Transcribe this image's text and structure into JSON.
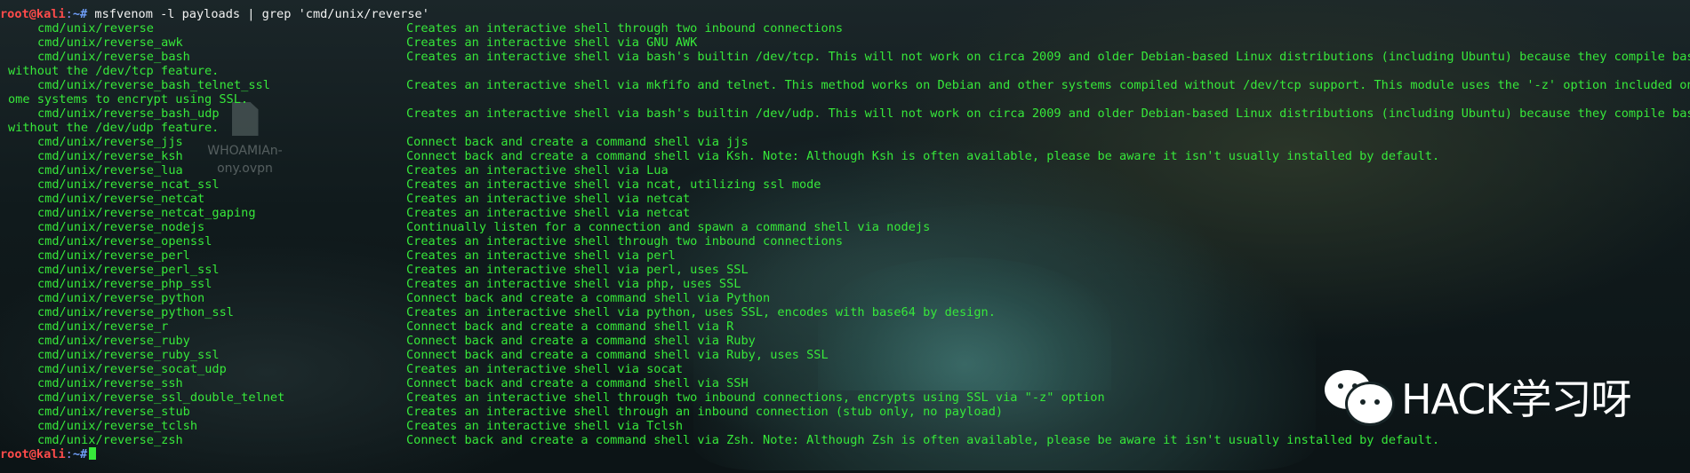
{
  "terminal": {
    "prompt": {
      "user_host": "root@kali",
      "separator": ":",
      "path": "~#"
    },
    "command": " msfvenom -l payloads | grep 'cmd/unix/reverse'",
    "payloads": [
      {
        "name": "cmd/unix/reverse",
        "desc": "Creates an interactive shell through two inbound connections"
      },
      {
        "name": "cmd/unix/reverse_awk",
        "desc": "Creates an interactive shell via GNU AWK"
      },
      {
        "name": "cmd/unix/reverse_bash",
        "desc": "Creates an interactive shell via bash's builtin /dev/tcp. This will not work on circa 2009 and older Debian-based Linux distributions (including Ubuntu) because they compile bash",
        "wrap": "without the /dev/tcp feature."
      },
      {
        "name": "cmd/unix/reverse_bash_telnet_ssl",
        "desc": "Creates an interactive shell via mkfifo and telnet. This method works on Debian and other systems compiled without /dev/tcp support. This module uses the '-z' option included on s",
        "wrap": "ome systems to encrypt using SSL."
      },
      {
        "name": "cmd/unix/reverse_bash_udp",
        "desc": "Creates an interactive shell via bash's builtin /dev/udp. This will not work on circa 2009 and older Debian-based Linux distributions (including Ubuntu) because they compile bash",
        "wrap": "without the /dev/udp feature."
      },
      {
        "name": "cmd/unix/reverse_jjs",
        "desc": "Connect back and create a command shell via jjs"
      },
      {
        "name": "cmd/unix/reverse_ksh",
        "desc": "Connect back and create a command shell via Ksh. Note: Although Ksh is often available, please be aware it isn't usually installed by default."
      },
      {
        "name": "cmd/unix/reverse_lua",
        "desc": "Creates an interactive shell via Lua"
      },
      {
        "name": "cmd/unix/reverse_ncat_ssl",
        "desc": "Creates an interactive shell via ncat, utilizing ssl mode"
      },
      {
        "name": "cmd/unix/reverse_netcat",
        "desc": "Creates an interactive shell via netcat"
      },
      {
        "name": "cmd/unix/reverse_netcat_gaping",
        "desc": "Creates an interactive shell via netcat"
      },
      {
        "name": "cmd/unix/reverse_nodejs",
        "desc": "Continually listen for a connection and spawn a command shell via nodejs"
      },
      {
        "name": "cmd/unix/reverse_openssl",
        "desc": "Creates an interactive shell through two inbound connections"
      },
      {
        "name": "cmd/unix/reverse_perl",
        "desc": "Creates an interactive shell via perl"
      },
      {
        "name": "cmd/unix/reverse_perl_ssl",
        "desc": "Creates an interactive shell via perl, uses SSL"
      },
      {
        "name": "cmd/unix/reverse_php_ssl",
        "desc": "Creates an interactive shell via php, uses SSL"
      },
      {
        "name": "cmd/unix/reverse_python",
        "desc": "Connect back and create a command shell via Python"
      },
      {
        "name": "cmd/unix/reverse_python_ssl",
        "desc": "Creates an interactive shell via python, uses SSL, encodes with base64 by design."
      },
      {
        "name": "cmd/unix/reverse_r",
        "desc": "Connect back and create a command shell via R"
      },
      {
        "name": "cmd/unix/reverse_ruby",
        "desc": "Connect back and create a command shell via Ruby"
      },
      {
        "name": "cmd/unix/reverse_ruby_ssl",
        "desc": "Connect back and create a command shell via Ruby, uses SSL"
      },
      {
        "name": "cmd/unix/reverse_socat_udp",
        "desc": "Creates an interactive shell via socat"
      },
      {
        "name": "cmd/unix/reverse_ssh",
        "desc": "Connect back and create a command shell via SSH"
      },
      {
        "name": "cmd/unix/reverse_ssl_double_telnet",
        "desc": "Creates an interactive shell through two inbound connections, encrypts using SSL via \"-z\" option"
      },
      {
        "name": "cmd/unix/reverse_stub",
        "desc": "Creates an interactive shell through an inbound connection (stub only, no payload)"
      },
      {
        "name": "cmd/unix/reverse_tclsh",
        "desc": "Creates an interactive shell via Tclsh"
      },
      {
        "name": "cmd/unix/reverse_zsh",
        "desc": "Connect back and create a command shell via Zsh. Note: Although Zsh is often available, please be aware it isn't usually installed by default."
      }
    ]
  },
  "desktop": {
    "file_label": "WHOAMIAn-\nony.ovpn",
    "file_icon": "document-icon"
  },
  "watermark": {
    "icon": "wechat-icon",
    "text": "HACK学习呀"
  },
  "colors": {
    "prompt_user": "#ff4b4b",
    "prompt_path": "#6f9ef8",
    "output_text": "#37e83a",
    "command_text": "#f2f2f2"
  }
}
